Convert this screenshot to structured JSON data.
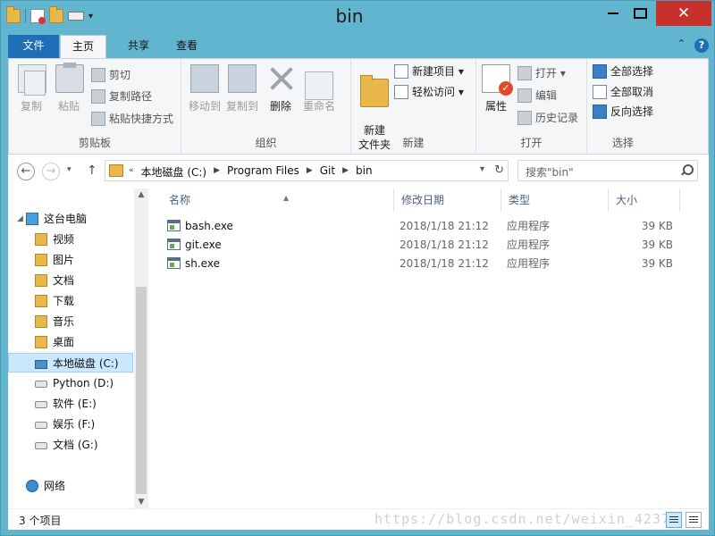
{
  "window": {
    "title": "bin",
    "close_glyph": "✕"
  },
  "ribbon_tabs": {
    "file": "文件",
    "home": "主页",
    "share": "共享",
    "view": "查看"
  },
  "ribbon": {
    "clipboard": {
      "label": "剪贴板",
      "copy": "复制",
      "paste": "粘贴",
      "cut": "剪切",
      "copy_path": "复制路径",
      "paste_shortcut": "粘贴快捷方式"
    },
    "organize": {
      "label": "组织",
      "move_to": "移动到",
      "copy_to": "复制到",
      "delete": "删除",
      "rename": "重命名"
    },
    "new": {
      "label": "新建",
      "new_folder": "新建\n文件夹",
      "new_item": "新建项目",
      "easy_access": "轻松访问"
    },
    "open": {
      "label": "打开",
      "properties": "属性",
      "open": "打开",
      "edit": "编辑",
      "history": "历史记录"
    },
    "select": {
      "label": "选择",
      "select_all": "全部选择",
      "select_none": "全部取消",
      "invert": "反向选择"
    }
  },
  "address": {
    "crumbs": [
      "本地磁盘 (C:)",
      "Program Files",
      "Git",
      "bin"
    ],
    "search_placeholder": "搜索\"bin\""
  },
  "nav_tree": [
    {
      "label": "这台电脑",
      "icon": "pc-icon"
    },
    {
      "label": "视频",
      "icon": "folder-icon"
    },
    {
      "label": "图片",
      "icon": "folder-icon"
    },
    {
      "label": "文档",
      "icon": "folder-icon"
    },
    {
      "label": "下载",
      "icon": "folder-icon"
    },
    {
      "label": "音乐",
      "icon": "folder-icon"
    },
    {
      "label": "桌面",
      "icon": "folder-icon"
    },
    {
      "label": "本地磁盘 (C:)",
      "icon": "drive-icon",
      "selected": true
    },
    {
      "label": "Python (D:)",
      "icon": "drive-icon"
    },
    {
      "label": "软件 (E:)",
      "icon": "drive-icon"
    },
    {
      "label": "娱乐 (F:)",
      "icon": "drive-icon"
    },
    {
      "label": "文档 (G:)",
      "icon": "drive-icon"
    },
    {
      "label": "网络",
      "icon": "network-icon"
    }
  ],
  "columns": {
    "name": "名称",
    "date": "修改日期",
    "type": "类型",
    "size": "大小"
  },
  "files": [
    {
      "name": "bash.exe",
      "date": "2018/1/18 21:12",
      "type": "应用程序",
      "size": "39 KB"
    },
    {
      "name": "git.exe",
      "date": "2018/1/18 21:12",
      "type": "应用程序",
      "size": "39 KB"
    },
    {
      "name": "sh.exe",
      "date": "2018/1/18 21:12",
      "type": "应用程序",
      "size": "39 KB"
    }
  ],
  "status": {
    "item_count": "3 个项目",
    "watermark": "https://blog.csdn.net/weixin_4237"
  },
  "colors": {
    "titlebar": "#62b5cf",
    "file_tab": "#1f6fb6",
    "close": "#c7312c",
    "selection": "#cce8ff"
  }
}
